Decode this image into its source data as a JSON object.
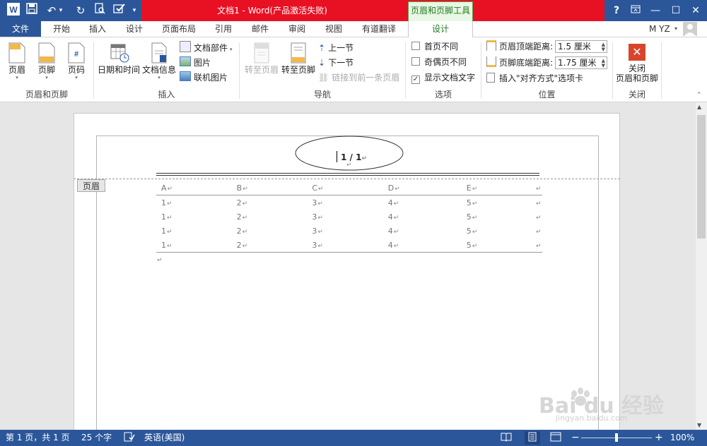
{
  "window": {
    "title": "文档1 - Word(产品激活失败)",
    "context_tool": "页眉和页脚工具",
    "help": "?",
    "user": "M YZ"
  },
  "tabs": [
    "文件",
    "开始",
    "插入",
    "设计",
    "页面布局",
    "引用",
    "邮件",
    "审阅",
    "视图",
    "有道翻译",
    "设计"
  ],
  "ribbon": {
    "group1": {
      "label": "页眉和页脚",
      "buttons": [
        "页眉",
        "页脚",
        "页码"
      ]
    },
    "group2": {
      "label": "插入",
      "datetime": "日期和时间",
      "docinfo": "文档信息",
      "quickparts": "文档部件",
      "picture": "图片",
      "onlinepic": "联机图片"
    },
    "group3": {
      "label": "导航",
      "goto_header": "转至页眉",
      "goto_footer": "转至页脚",
      "prev": "上一节",
      "next": "下一节",
      "link_prev": "链接到前一条页眉"
    },
    "group4": {
      "label": "选项",
      "first_page": "首页不同",
      "odd_even": "奇偶页不同",
      "show_doc_text": "显示文档文字"
    },
    "group5": {
      "label": "位置",
      "header_top": "页眉顶端距离:",
      "header_top_value": "1.5 厘米",
      "footer_bottom": "页脚底端距离:",
      "footer_bottom_value": "1.75 厘米",
      "insert_tab": "插入\"对齐方式\"选项卡"
    },
    "group6": {
      "label": "关闭",
      "close_line1": "关闭",
      "close_line2": "页眉和页脚"
    }
  },
  "document": {
    "header_label": "页眉",
    "page_number": "1 / 1",
    "table": {
      "headers": [
        "A",
        "B",
        "C",
        "D",
        "E"
      ],
      "rows": [
        [
          "1",
          "2",
          "3",
          "4",
          "5"
        ],
        [
          "1",
          "2",
          "3",
          "4",
          "5"
        ],
        [
          "1",
          "2",
          "3",
          "4",
          "5"
        ],
        [
          "1",
          "2",
          "3",
          "4",
          "5"
        ]
      ]
    }
  },
  "status": {
    "page": "第 1 页，共 1 页",
    "words": "25 个字",
    "language": "英语(美国)",
    "zoom": "100%"
  },
  "watermark": {
    "text": "Bai du 经验",
    "url": "jingyan.baidu.com"
  },
  "colors": {
    "title_bar": "#2b579a",
    "activation_red": "#e81123",
    "tool_green": "#1f7a1f"
  }
}
